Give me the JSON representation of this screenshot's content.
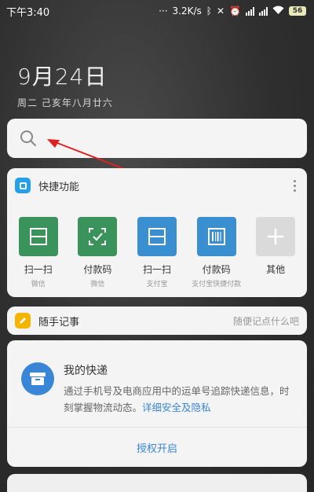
{
  "status_bar": {
    "time": "下午3:40",
    "speed": "3.2K/s",
    "battery": "56"
  },
  "date": {
    "main": "9月24日",
    "sub": "周二 己亥年八月廿六"
  },
  "quick_functions": {
    "title": "快捷功能",
    "items": [
      {
        "label": "扫一扫",
        "sub": "微信"
      },
      {
        "label": "付款码",
        "sub": "微信"
      },
      {
        "label": "扫一扫",
        "sub": "支付宝"
      },
      {
        "label": "付款码",
        "sub": "支付宝快捷付款"
      },
      {
        "label": "其他",
        "sub": ""
      }
    ]
  },
  "notes": {
    "title": "随手记事",
    "hint": "随便记点什么吧"
  },
  "express": {
    "title": "我的快递",
    "desc": "通过手机号及电商应用中的运单号追踪快递信息，时刻掌握物流动态。",
    "link": "详细安全及隐私",
    "auth_button": "授权开启"
  },
  "colors": {
    "wechat_green": "#39935a",
    "alipay_blue": "#3a8fd1",
    "accent_blue": "#3a86d6",
    "note_yellow": "#f4b400"
  }
}
